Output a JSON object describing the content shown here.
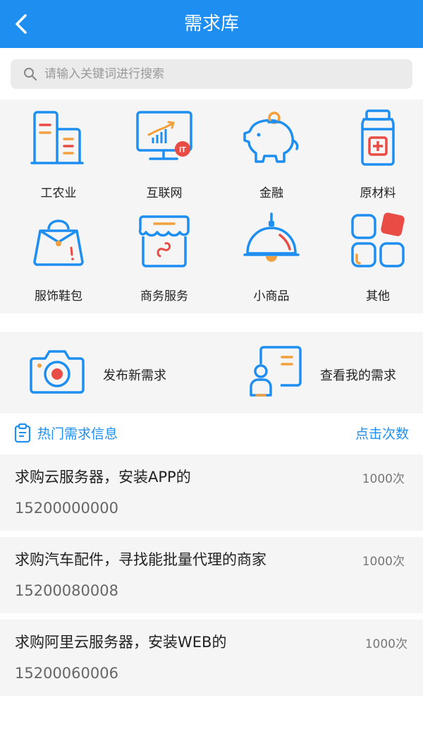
{
  "header": {
    "title": "需求库"
  },
  "search": {
    "placeholder": "请输入关键词进行搜索"
  },
  "categories": [
    {
      "label": "工农业",
      "icon": "building-icon"
    },
    {
      "label": "互联网",
      "icon": "monitor-chart-icon"
    },
    {
      "label": "金融",
      "icon": "piggy-bank-icon"
    },
    {
      "label": "原材料",
      "icon": "jar-icon"
    },
    {
      "label": "服饰鞋包",
      "icon": "handbag-icon"
    },
    {
      "label": "商务服务",
      "icon": "store-icon"
    },
    {
      "label": "小商品",
      "icon": "bell-lamp-icon"
    },
    {
      "label": "其他",
      "icon": "grid-apps-icon"
    }
  ],
  "actions": [
    {
      "label": "发布新需求",
      "icon": "camera-icon"
    },
    {
      "label": "查看我的需求",
      "icon": "profile-card-icon"
    }
  ],
  "hot": {
    "title": "热门需求信息",
    "right": "点击次数"
  },
  "items": [
    {
      "title": "求购云服务器，安装APP的",
      "count": "1000次",
      "phone": "15200000000"
    },
    {
      "title": "求购汽车配件，寻找能批量代理的商家",
      "count": "1000次",
      "phone": "15200080008"
    },
    {
      "title": "求购阿里云服务器，安装WEB的",
      "count": "1000次",
      "phone": "15200060006"
    }
  ],
  "colors": {
    "primary": "#1e8ff0",
    "accent_red": "#e94b45",
    "accent_orange": "#f2a03d"
  }
}
